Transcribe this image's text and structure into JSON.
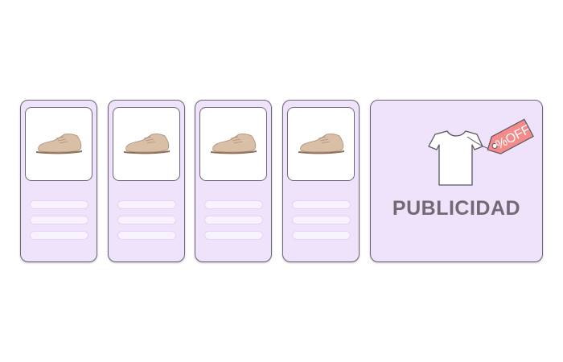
{
  "product_cards": [
    {
      "image_icon": "shoe-icon"
    },
    {
      "image_icon": "shoe-icon"
    },
    {
      "image_icon": "shoe-icon"
    },
    {
      "image_icon": "shoe-icon"
    }
  ],
  "ad": {
    "label": "PUBLICIDAD",
    "tag_text": "%OFF",
    "icon": "tshirt-icon",
    "tag_icon": "price-tag-icon"
  },
  "colors": {
    "card_bg": "#eee3fb",
    "border": "#6e6678",
    "shoe": "#d9bfa6",
    "tag": "#f48b8b"
  }
}
